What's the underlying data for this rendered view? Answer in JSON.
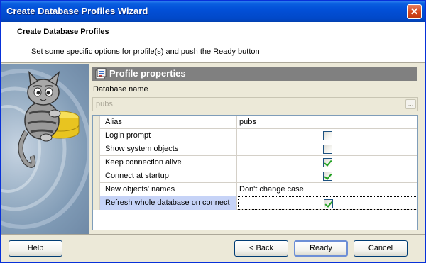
{
  "window": {
    "title": "Create Database Profiles Wizard",
    "close_label": "✕"
  },
  "header": {
    "title": "Create Database Profiles",
    "subtitle": "Set some specific options for profile(s) and push the Ready button"
  },
  "group": {
    "title": "Profile properties",
    "icon": "properties-icon"
  },
  "database": {
    "label": "Database name",
    "value": "pubs",
    "browse_label": "..."
  },
  "properties": [
    {
      "name": "Alias",
      "value": "pubs",
      "type": "text"
    },
    {
      "name": "Login prompt",
      "checked": false,
      "type": "checkbox"
    },
    {
      "name": "Show system objects",
      "checked": false,
      "type": "checkbox"
    },
    {
      "name": "Keep connection alive",
      "checked": true,
      "type": "checkbox"
    },
    {
      "name": "Connect at startup",
      "checked": true,
      "type": "checkbox"
    },
    {
      "name": "New objects' names",
      "value": "Don't change case",
      "type": "text"
    },
    {
      "name": "Refresh whole database on connect",
      "checked": true,
      "type": "checkbox",
      "selected": true
    }
  ],
  "buttons": {
    "help": "Help",
    "back": "< Back",
    "ready": "Ready",
    "cancel": "Cancel"
  },
  "colors": {
    "title_bar": "#0250d8",
    "accent": "#808080",
    "selection": "#c6d3f7",
    "check": "#21a121"
  }
}
